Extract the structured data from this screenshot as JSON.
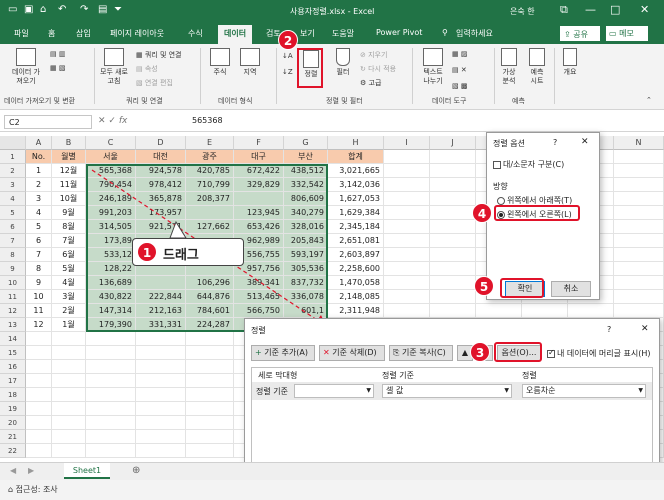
{
  "titlebar": {
    "title": "사용자정렬.xlsx  -  Excel",
    "user": "은숙 한",
    "restore_icon": "⧉",
    "min": "—",
    "max": "□",
    "close": "✕"
  },
  "tabs": [
    "파일",
    "홈",
    "삽입",
    "페이지 레이아웃",
    "수식",
    "데이터",
    "검토",
    "보기",
    "도움말",
    "Power Pivot"
  ],
  "search_label": "입력하세요",
  "share_label": "공유",
  "memo_label": "메모",
  "ribbon": {
    "get_data": "데이터 가\n져오기",
    "refresh_all": "모두 새로\n고침",
    "queries": "쿼리 및 연결",
    "properties": "속성",
    "edit_links": "연결 편집",
    "stocks": "주식",
    "geography": "지역",
    "sort": "정렬",
    "filter": "필터",
    "clear": "지우기",
    "reapply": "다시 적용",
    "advanced": "고급",
    "text_to_columns": "텍스트\n나누기",
    "whatif": "가상\n분석",
    "forecast": "예측\n시트",
    "outline": "개요",
    "groups": {
      "get": "데이터 가져오기 및 변환",
      "queries": "쿼리 및 연결",
      "types": "데이터 형식",
      "sortfilter": "정렬 및 필터",
      "tools": "데이터 도구",
      "forecast": "예측"
    }
  },
  "formula": {
    "namebox": "C2",
    "fx": "fx",
    "value": "565368"
  },
  "columns": [
    "A",
    "B",
    "C",
    "D",
    "E",
    "F",
    "G",
    "H",
    "I",
    "J",
    "K",
    "L",
    "M",
    "N"
  ],
  "rows": [
    "1",
    "2",
    "3",
    "4",
    "5",
    "6",
    "7",
    "8",
    "9",
    "10",
    "11",
    "12",
    "13",
    "14",
    "15",
    "16",
    "17",
    "18",
    "19",
    "20",
    "21",
    "22"
  ],
  "table": {
    "headers": [
      "No.",
      "월별",
      "서울",
      "대전",
      "광주",
      "대구",
      "부산",
      "합계"
    ],
    "data": [
      [
        "1",
        "12월",
        "565,368",
        "924,578",
        "420,785",
        "672,422",
        "438,512",
        "3,021,665"
      ],
      [
        "2",
        "11월",
        "790,454",
        "978,412",
        "710,799",
        "329,829",
        "332,542",
        "3,142,036"
      ],
      [
        "3",
        "10월",
        "246,189",
        "365,878",
        "208,377",
        "",
        "806,609",
        "1,627,053"
      ],
      [
        "4",
        "9월",
        "991,203",
        "173,957",
        "",
        "123,945",
        "340,279",
        "1,629,384"
      ],
      [
        "5",
        "8월",
        "314,505",
        "921,571",
        "127,662",
        "653,426",
        "328,016",
        "2,345,184"
      ],
      [
        "6",
        "7월",
        "173,89",
        "",
        "",
        "962,989",
        "205,843",
        "2,651,081"
      ],
      [
        "7",
        "6월",
        "533,12",
        "",
        "",
        "556,755",
        "593,197",
        "2,603,897"
      ],
      [
        "8",
        "5월",
        "128,22",
        "",
        "",
        "957,756",
        "305,536",
        "2,258,600"
      ],
      [
        "9",
        "4월",
        "136,689",
        "",
        "106,296",
        "389,341",
        "837,732",
        "1,470,058"
      ],
      [
        "10",
        "3월",
        "430,822",
        "222,844",
        "644,876",
        "513,465",
        "336,078",
        "2,148,085"
      ],
      [
        "11",
        "2월",
        "147,314",
        "212,163",
        "784,601",
        "566,750",
        "601,1",
        "2,311,948"
      ],
      [
        "12",
        "1월",
        "179,390",
        "331,331",
        "224,287",
        "",
        "",
        ""
      ]
    ]
  },
  "drag_label": "드래그",
  "sheet_tab": "Sheet1",
  "status_text": "접근성: 조사",
  "options_dialog": {
    "title": "정렬 옵션",
    "help": "?",
    "close": "✕",
    "case_sensitive": "대/소문자 구분(C)",
    "direction_label": "방향",
    "top_to_bottom": "위쪽에서 아래쪽(T)",
    "left_to_right": "왼쪽에서 오른쪽(L)",
    "ok": "확인",
    "cancel": "취소"
  },
  "sort_dialog": {
    "title": "정렬",
    "help": "?",
    "close": "✕",
    "add_level": "기준 추가(A)",
    "delete_level": "기준 삭제(D)",
    "copy_level": "기준 복사(C)",
    "options": "옵션(O)...",
    "header_chk": "내 데이터에 머리글 표시(H)",
    "col_row": "세로 막대형",
    "col_sorton": "정렬 기준",
    "col_order": "정렬",
    "row_label": "정렬 기준",
    "sort_on_value": "셀 값",
    "order_value": "오름차순",
    "ok": "확인",
    "cancel": "취소"
  },
  "badges": [
    "1",
    "2",
    "3",
    "4",
    "5"
  ],
  "colors": {
    "excel_green": "#217346",
    "highlight_red": "#e0132a",
    "header_fill": "#f8cbad",
    "selection": "#c6dbc9"
  }
}
